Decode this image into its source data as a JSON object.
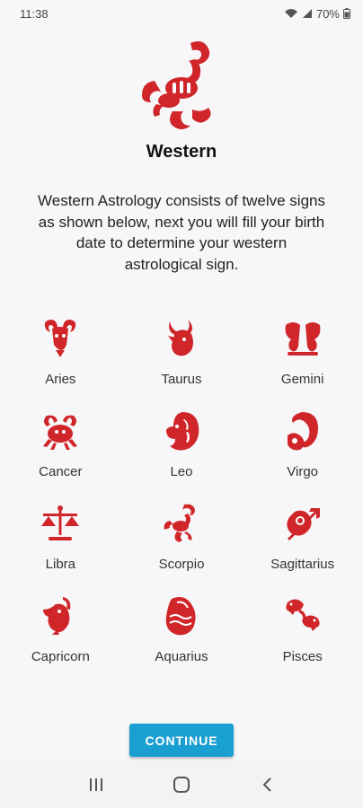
{
  "status": {
    "time": "11:38",
    "battery": "70%"
  },
  "colors": {
    "accent_red": "#d0262a",
    "button_blue": "#1a9fd3"
  },
  "hero": {
    "icon": "scorpion-icon",
    "title": "Western",
    "description": "Western Astrology consists of twelve signs as shown below, next you will fill your birth date to determine your western astrological sign."
  },
  "signs": [
    {
      "label": "Aries",
      "icon": "aries-icon"
    },
    {
      "label": "Taurus",
      "icon": "taurus-icon"
    },
    {
      "label": "Gemini",
      "icon": "gemini-icon"
    },
    {
      "label": "Cancer",
      "icon": "cancer-icon"
    },
    {
      "label": "Leo",
      "icon": "leo-icon"
    },
    {
      "label": "Virgo",
      "icon": "virgo-icon"
    },
    {
      "label": "Libra",
      "icon": "libra-icon"
    },
    {
      "label": "Scorpio",
      "icon": "scorpio-icon"
    },
    {
      "label": "Sagittarius",
      "icon": "sagittarius-icon"
    },
    {
      "label": "Capricorn",
      "icon": "capricorn-icon"
    },
    {
      "label": "Aquarius",
      "icon": "aquarius-icon"
    },
    {
      "label": "Pisces",
      "icon": "pisces-icon"
    }
  ],
  "continue_label": "CONTINUE",
  "nav": {
    "recents_icon": "recents-icon",
    "home_icon": "home-icon",
    "back_icon": "back-icon"
  }
}
